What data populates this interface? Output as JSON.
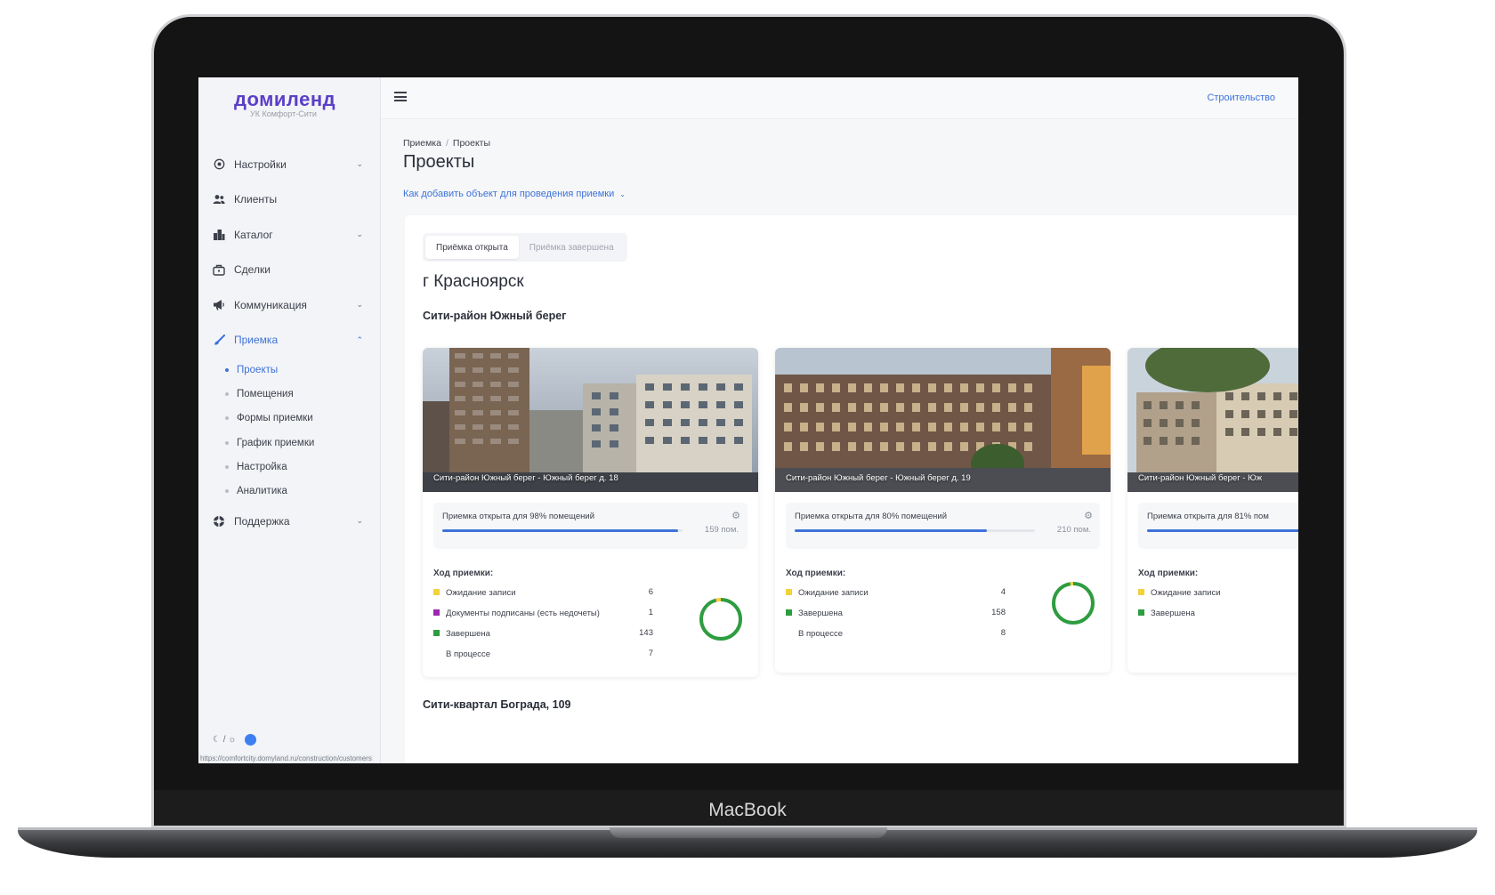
{
  "device_label": "MacBook",
  "app": {
    "logo": "домиленд",
    "logo_sub": "УК Комфорт-Сити"
  },
  "topbar": {
    "link": "Строительство"
  },
  "sidebar": {
    "items": [
      {
        "label": "Настройки",
        "icon": "settings-icon"
      },
      {
        "label": "Клиенты",
        "icon": "users-icon"
      },
      {
        "label": "Каталог",
        "icon": "buildings-icon"
      },
      {
        "label": "Сделки",
        "icon": "briefcase-icon"
      },
      {
        "label": "Коммуникация",
        "icon": "megaphone-icon"
      },
      {
        "label": "Приемка",
        "icon": "brush-icon"
      },
      {
        "label": "Поддержка",
        "icon": "lifebuoy-icon"
      }
    ],
    "subitems": [
      "Проекты",
      "Помещения",
      "Формы приемки",
      "График приемки",
      "Настройка",
      "Аналитика"
    ],
    "theme_toggle": "☾ / ☼",
    "status_url": "https://comfortcity.domyland.ru/construction/customers"
  },
  "breadcrumb": {
    "parent": "Приемка",
    "separator": "/",
    "current": "Проекты"
  },
  "page": {
    "title": "Проекты",
    "howto": "Как добавить объект для проведения приемки"
  },
  "tabs": [
    "Приёмка открыта",
    "Приёмка завершена"
  ],
  "city": "г Красноярск",
  "districts": [
    "Сити-район Южный берег",
    "Сити-квартал Бограда, 109"
  ],
  "colors": {
    "accent": "#3d72d9",
    "brand": "#5b3fc8",
    "waiting": "#f2d23a",
    "docs_signed": "#9c27b0",
    "done": "#2e9d40"
  },
  "cards": [
    {
      "caption": "Сити-район Южный берег - Южный берег д. 18",
      "progress_text": "Приемка открыта для 98% помещений",
      "progress": 98,
      "count": "159 пом.",
      "progress_title": "Ход приемки:",
      "legend": [
        {
          "label": "Ожидание записи",
          "value": "6",
          "color": "#f2d23a"
        },
        {
          "label": "Документы подписаны (есть недочеты)",
          "value": "1",
          "color": "#9c27b0"
        },
        {
          "label": "Завершена",
          "value": "143",
          "color": "#2e9d40"
        },
        {
          "label": "В процессе",
          "value": "7",
          "color": ""
        }
      ]
    },
    {
      "caption": "Сити-район Южный берег - Южный берег д. 19",
      "progress_text": "Приемка открыта для 80% помещений",
      "progress": 80,
      "count": "210 пом.",
      "progress_title": "Ход приемки:",
      "legend": [
        {
          "label": "Ожидание записи",
          "value": "4",
          "color": "#f2d23a"
        },
        {
          "label": "Завершена",
          "value": "158",
          "color": "#2e9d40"
        },
        {
          "label": "В процессе",
          "value": "8",
          "color": ""
        }
      ]
    },
    {
      "caption": "Сити-район Южный берег - Юж",
      "progress_text": "Приемка открыта для 81% пом",
      "progress": 81,
      "count": "",
      "progress_title": "Ход приемки:",
      "legend": [
        {
          "label": "Ожидание записи",
          "value": "",
          "color": "#f2d23a"
        },
        {
          "label": "Завершена",
          "value": "",
          "color": "#2e9d40"
        }
      ]
    }
  ]
}
